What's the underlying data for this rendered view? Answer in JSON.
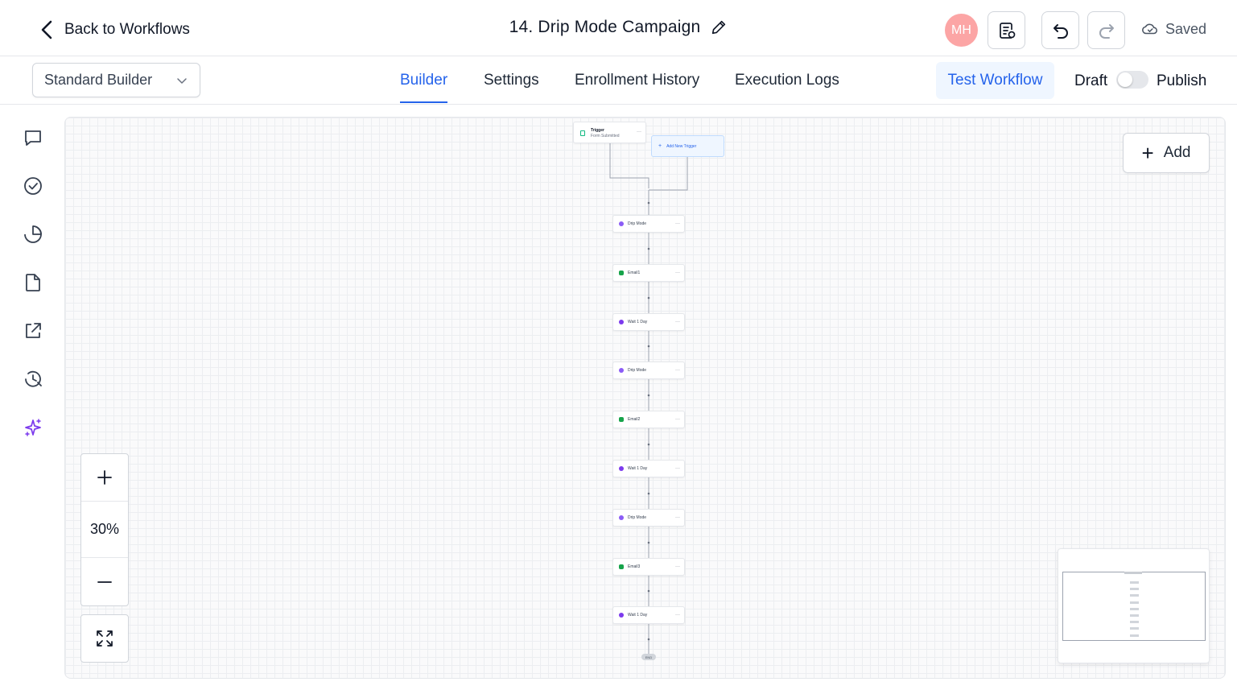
{
  "header": {
    "back_label": "Back to Workflows",
    "title": "14. Drip Mode Campaign",
    "avatar_initials": "MH",
    "status": "Saved"
  },
  "subbar": {
    "builder_select_value": "Standard Builder",
    "tabs": [
      {
        "label": "Builder",
        "active": true
      },
      {
        "label": "Settings",
        "active": false
      },
      {
        "label": "Enrollment History",
        "active": false
      },
      {
        "label": "Execution Logs",
        "active": false
      }
    ],
    "test_workflow_label": "Test Workflow",
    "draft_label": "Draft",
    "publish_label": "Publish",
    "published": false
  },
  "sidebar": {
    "icons": [
      "chat-bubble-icon",
      "check-circle-icon",
      "pie-chart-icon",
      "document-icon",
      "external-link-icon",
      "history-clock-icon",
      "sparkles-icon"
    ]
  },
  "canvas": {
    "add_label": "Add",
    "zoom_level": "30%",
    "trigger": {
      "title": "Trigger",
      "subtitle": "Form Submitted"
    },
    "add_trigger_label": "Add New Trigger",
    "nodes": [
      {
        "label": "Drip Mode",
        "kind": "drip"
      },
      {
        "label": "Email1",
        "kind": "email"
      },
      {
        "label": "Wait 1 Day",
        "kind": "wait"
      },
      {
        "label": "Drip Mode",
        "kind": "drip"
      },
      {
        "label": "Email2",
        "kind": "email"
      },
      {
        "label": "Wait 1 Day",
        "kind": "wait"
      },
      {
        "label": "Drip Mode",
        "kind": "drip"
      },
      {
        "label": "Email3",
        "kind": "email"
      },
      {
        "label": "Wait 1 Day",
        "kind": "wait"
      }
    ],
    "end_label": "END",
    "node_colors": {
      "drip": "#8b5cf6",
      "email": "#16a34a",
      "wait": "#7c3aed"
    }
  },
  "colors": {
    "accent": "#2563eb",
    "avatar": "#fca5a5",
    "sparkle": "#7c3aed"
  }
}
